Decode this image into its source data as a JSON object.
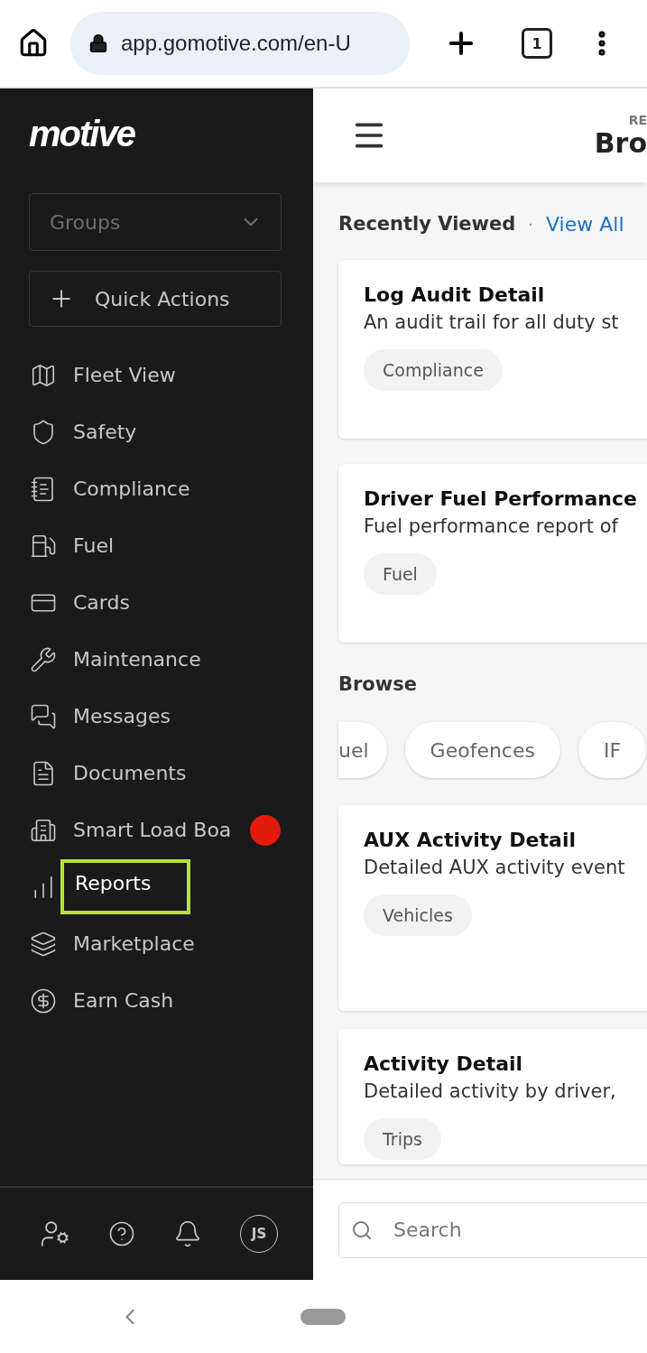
{
  "browser": {
    "url": "app.gomotive.com/en-U",
    "tab_count": "1"
  },
  "sidebar": {
    "logo": "motive",
    "groups": {
      "placeholder": "Groups"
    },
    "quick_actions": "Quick Actions",
    "items": [
      {
        "label": "Fleet View",
        "selected": false,
        "dot": false
      },
      {
        "label": "Safety",
        "selected": false,
        "dot": false
      },
      {
        "label": "Compliance",
        "selected": false,
        "dot": false
      },
      {
        "label": "Fuel",
        "selected": false,
        "dot": false
      },
      {
        "label": "Cards",
        "selected": false,
        "dot": false
      },
      {
        "label": "Maintenance",
        "selected": false,
        "dot": false
      },
      {
        "label": "Messages",
        "selected": false,
        "dot": false
      },
      {
        "label": "Documents",
        "selected": false,
        "dot": false
      },
      {
        "label": "Smart Load Boa",
        "selected": false,
        "dot": true
      },
      {
        "label": "Reports",
        "selected": true,
        "dot": false
      },
      {
        "label": "Marketplace",
        "selected": false,
        "dot": false
      },
      {
        "label": "Earn Cash",
        "selected": false,
        "dot": false
      }
    ],
    "avatar": "JS"
  },
  "header": {
    "eyebrow": "RE",
    "title": "Bro"
  },
  "recent": {
    "title": "Recently Viewed",
    "separator": "·",
    "link": "View All",
    "cards": [
      {
        "title": "Log Audit Detail",
        "description": "An audit trail for all duty st",
        "tag": "Compliance"
      },
      {
        "title": "Driver Fuel Performance",
        "description": "Fuel performance report of",
        "tag": "Fuel"
      }
    ]
  },
  "browse": {
    "title": "Browse",
    "chips": [
      "uel",
      "Geofences",
      "IF"
    ],
    "cards": [
      {
        "title": "AUX Activity Detail",
        "description": "Detailed AUX activity event",
        "tag": "Vehicles"
      },
      {
        "title": "Activity Detail",
        "description": "Detailed activity by driver,",
        "tag": "Trips"
      }
    ]
  },
  "search": {
    "placeholder": "Search"
  }
}
